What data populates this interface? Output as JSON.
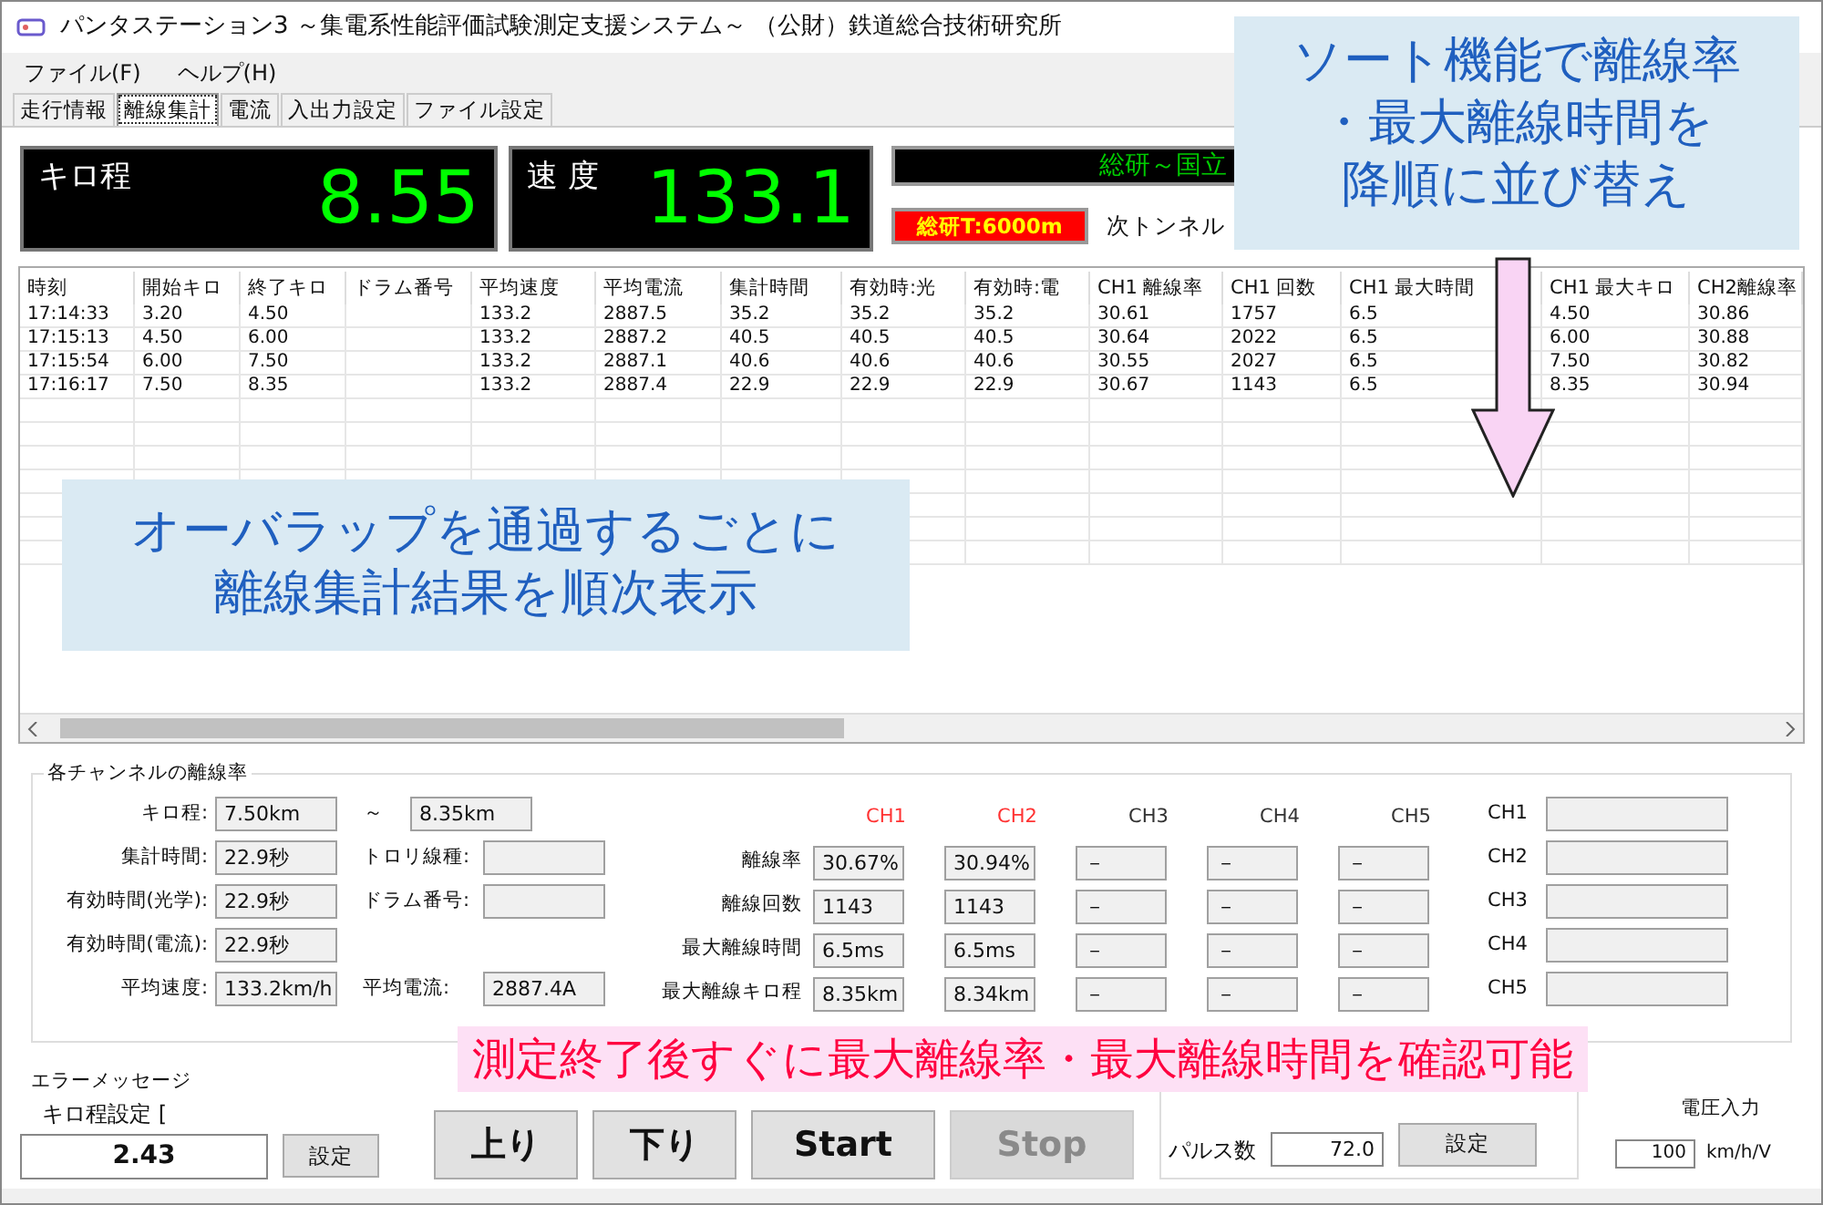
{
  "window": {
    "title": "パンタステーション3 ～集電系性能評価試験測定支援システム～ （公財）鉄道総合技術研究所"
  },
  "menu": [
    "ファイル(F)",
    "ヘルプ(H)"
  ],
  "tabs": [
    {
      "label": "走行情報",
      "selected": false
    },
    {
      "label": "離線集計",
      "selected": true
    },
    {
      "label": "電流",
      "selected": false
    },
    {
      "label": "入出力設定",
      "selected": false
    },
    {
      "label": "ファイル設定",
      "selected": false
    }
  ],
  "displays": [
    {
      "label": "キロ程",
      "value": "8.55"
    },
    {
      "label": "速 度",
      "value": "133.1"
    }
  ],
  "section_display": "総研～国立",
  "tunnel": {
    "badge": "総研T:6000m",
    "label": "次トンネル"
  },
  "table": {
    "columns": [
      "時刻",
      "開始キロ",
      "終了キロ",
      "ドラム番号",
      "平均速度",
      "平均電流",
      "集計時間",
      "有効時:光",
      "有効時:電",
      "CH1 離線率",
      "CH1 回数",
      "CH1 最大時間",
      "CH1 最大キロ",
      "CH2離線率"
    ],
    "rows": [
      [
        "17:14:33",
        "3.20",
        "4.50",
        null,
        "133.2",
        "2887.5",
        "35.2",
        "35.2",
        "35.2",
        "30.61",
        "1757",
        "6.5",
        "4.50",
        "30.86"
      ],
      [
        "17:15:13",
        "4.50",
        "6.00",
        null,
        "133.2",
        "2887.2",
        "40.5",
        "40.5",
        "40.5",
        "30.64",
        "2022",
        "6.5",
        "6.00",
        "30.88"
      ],
      [
        "17:15:54",
        "6.00",
        "7.50",
        null,
        "133.2",
        "2887.1",
        "40.6",
        "40.6",
        "40.6",
        "30.55",
        "2027",
        "6.5",
        "7.50",
        "30.82"
      ],
      [
        "17:16:17",
        "7.50",
        "8.35",
        null,
        "133.2",
        "2887.4",
        "22.9",
        "22.9",
        "22.9",
        "30.67",
        "1143",
        "6.5",
        "8.35",
        "30.94"
      ]
    ]
  },
  "group": {
    "title": "各チャンネルの離線率",
    "kilo": {
      "label": "キロ程:",
      "from": "7.50km",
      "sep": "～",
      "to": "8.35km"
    },
    "fields": [
      {
        "label": "集計時間:",
        "value": "22.9秒",
        "label2": "トロリ線種:"
      },
      {
        "label": "有効時間(光学):",
        "value": "22.9秒",
        "label2": "ドラム番号:"
      },
      {
        "label": "有効時間(電流):",
        "value": "22.9秒"
      },
      {
        "label": "平均速度:",
        "value": "133.2km/h",
        "label2": "平均電流:",
        "value2": "2887.4A"
      }
    ],
    "metrics": [
      "離線率",
      "離線回数",
      "最大離線時間",
      "最大離線キロ程"
    ],
    "channels": [
      {
        "label": "CH1",
        "color": "#ff3333",
        "values": [
          "30.67%",
          "1143",
          "6.5ms",
          "8.35km"
        ]
      },
      {
        "label": "CH2",
        "color": "#ff3333",
        "values": [
          "30.94%",
          "1143",
          "6.5ms",
          "8.34km"
        ]
      },
      {
        "label": "CH3",
        "color": "#333333",
        "values": [
          "－",
          "－",
          "－",
          "－"
        ]
      },
      {
        "label": "CH4",
        "color": "#333333",
        "values": [
          "－",
          "－",
          "－",
          "－"
        ]
      },
      {
        "label": "CH5",
        "color": "#333333",
        "values": [
          "－",
          "－",
          "－",
          "－"
        ]
      }
    ],
    "side_channels": [
      "CH1",
      "CH2",
      "CH3",
      "CH4",
      "CH5"
    ]
  },
  "bottom": {
    "error_label": "エラーメッセージ",
    "kilo_label": "キロ程設定 [",
    "kilo_value": "2.43",
    "set": "設定",
    "buttons": [
      {
        "label": "上り",
        "disabled": false
      },
      {
        "label": "下り",
        "disabled": false
      },
      {
        "label": "Start",
        "disabled": false
      },
      {
        "label": "Stop",
        "disabled": true
      }
    ],
    "pulse_label": "パルス数",
    "pulse_value": "72.0",
    "pulse_set": "設定",
    "voltage_label": "電圧入力",
    "voltage_value": "100",
    "voltage_unit": "km/h/V"
  },
  "callouts": [
    {
      "kind": "blue",
      "lines": [
        "ソート機能で離線率",
        "・最大離線時間を",
        "降順に並び替え"
      ]
    },
    {
      "kind": "blue",
      "lines": [
        "オーバラップを通過するごとに",
        "離線集計結果を順次表示"
      ]
    },
    {
      "kind": "pink",
      "lines": [
        "測定終了後すぐに最大離線率・最大離線時間を確認可能"
      ]
    }
  ]
}
